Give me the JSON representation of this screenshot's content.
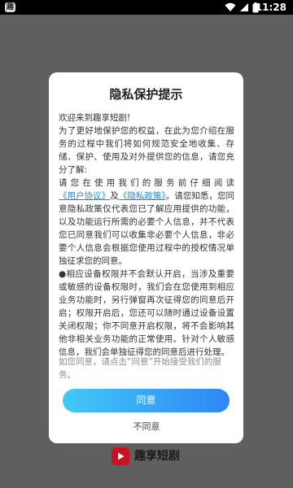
{
  "status_bar": {
    "time": "11:28",
    "app_icon_label": "趣",
    "icons": [
      "wifi-icon",
      "signal-icon",
      "battery-icon"
    ]
  },
  "background": {
    "logo_text": "趣享短剧",
    "logo_color": "#c9121f"
  },
  "dialog": {
    "title": "隐私保护提示",
    "greeting": "欢迎来到趣享短剧!",
    "para1": "为了更好地保护您的权益，在此为您介绍在服务的过程中我们将如何规范安全地收集、存储、保护、使用及对外提供您的信息，请您充分了解:",
    "para2_prefix": "请您在使用我们的服务前仔细阅读",
    "user_agreement_link": "《用户协议》",
    "and_text": "及",
    "privacy_policy_link": "《隐私政策》",
    "para2_suffix": "。请您知悉，您同意隐私政策仅代表您已了解应用提供的功能，以及功能运行所需的必要个人信息，并不代表您已同意我们可以收集非必要个人信息，非必要个人信息会根据您使用过程中的授权情况单独征求您的同意。",
    "para3": "●相应设备权限并不会默认开启，当涉及重要或敏感的设备权限时，我们会在您使用到相应业务功能时，另行弹窗再次征得您的同意后开启；权限开启后，您还可以随时通过设备设置关闭权限；你不同意开启权限，将不会影响其他非相关业务功能的正常使用。针对个人敏感信息，我们会单独征得您的同意后进行处理。",
    "consent_hint": "如您同意，请点击“同意”开始接受我们的服务。",
    "agree_label": "同意",
    "disagree_label": "不同意",
    "accent_colors": {
      "gradient_start": "#41c9f7",
      "gradient_end": "#2f86f6",
      "link": "#1e88e5"
    }
  }
}
